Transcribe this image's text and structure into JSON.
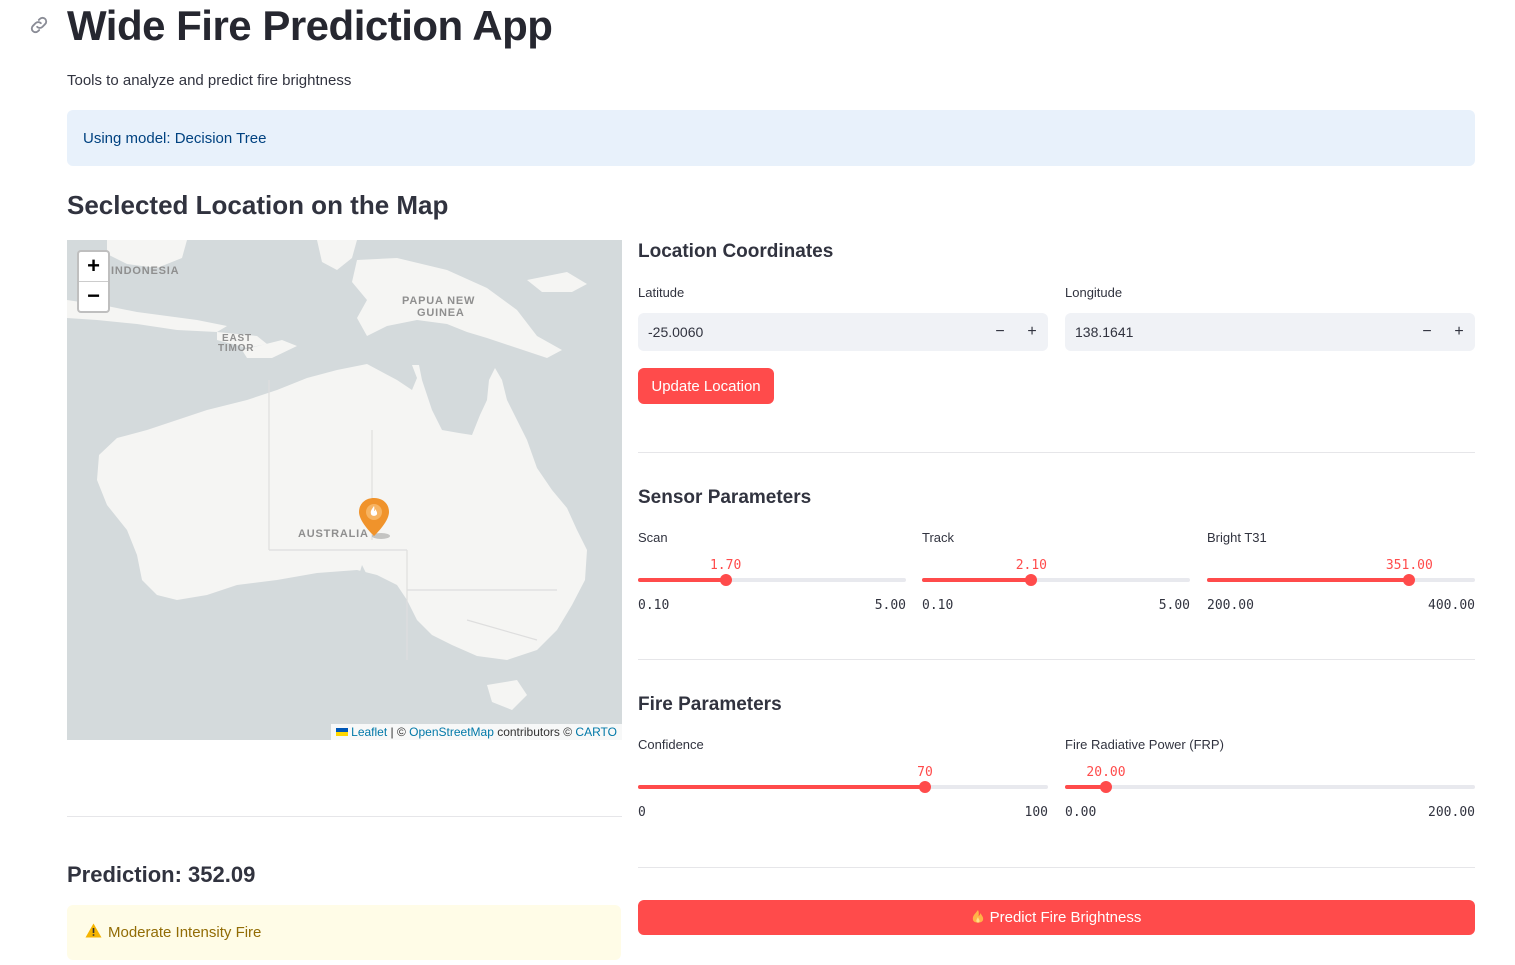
{
  "app": {
    "title": "Wide Fire Prediction App",
    "subtitle": "Tools to analyze and predict fire brightness",
    "model_info": "Using model: Decision Tree"
  },
  "map_section": {
    "heading": "Seclected Location on the Map",
    "zoom_in": "+",
    "zoom_out": "−",
    "labels": {
      "indonesia": "INDONESIA",
      "png_line1": "PAPUA NEW",
      "png_line2": "GUINEA",
      "timor_line1": "EAST",
      "timor_line2": "TIMOR",
      "australia": "AUSTRALIA"
    },
    "attribution": {
      "leaflet": "Leaflet",
      "sep": " | © ",
      "osm": "OpenStreetMap",
      "contributors": " contributors © ",
      "carto": "CARTO"
    },
    "marker_icon": "fire-pin-icon"
  },
  "location": {
    "heading": "Location Coordinates",
    "latitude_label": "Latitude",
    "latitude_value": "-25.0060",
    "longitude_label": "Longitude",
    "longitude_value": "138.1641",
    "minus": "−",
    "plus": "+",
    "update_button": "Update Location"
  },
  "sensor": {
    "heading": "Sensor Parameters",
    "scan": {
      "label": "Scan",
      "value": "1.70",
      "min": "0.10",
      "max": "5.00",
      "fraction": 0.327
    },
    "track": {
      "label": "Track",
      "value": "2.10",
      "min": "0.10",
      "max": "5.00",
      "fraction": 0.408
    },
    "bright_t31": {
      "label": "Bright T31",
      "value": "351.00",
      "min": "200.00",
      "max": "400.00",
      "fraction": 0.755
    }
  },
  "fire": {
    "heading": "Fire Parameters",
    "confidence": {
      "label": "Confidence",
      "value": "70",
      "min": "0",
      "max": "100",
      "fraction": 0.7
    },
    "frp": {
      "label": "Fire Radiative Power (FRP)",
      "value": "20.00",
      "min": "0.00",
      "max": "200.00",
      "fraction": 0.1
    }
  },
  "prediction": {
    "heading": "Prediction: 352.09",
    "status": "Moderate Intensity Fire",
    "status_icon": "warning-icon",
    "predict_button": "Predict Fire Brightness",
    "predict_icon": "fire-icon"
  },
  "colors": {
    "accent": "#ff4b4b",
    "info_bg": "#e8f1fb",
    "info_text": "#004280",
    "warning_bg": "#fffce7",
    "warning_text": "#926c05",
    "map_water": "#d4dadc",
    "map_land": "#f5f5f3"
  }
}
